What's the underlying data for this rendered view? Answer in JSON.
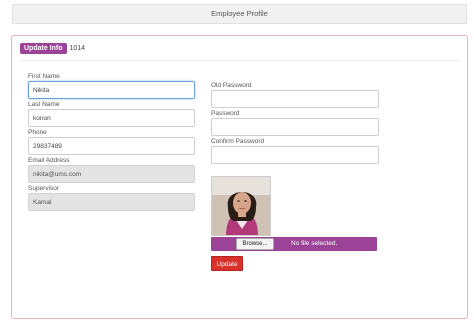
{
  "header": {
    "title": "Employee Profile"
  },
  "panel": {
    "badge": "Update Info",
    "employee_id": "1014"
  },
  "form": {
    "first_name": {
      "label": "First Name",
      "value": "Nikita"
    },
    "last_name": {
      "label": "Last Name",
      "value": "konon"
    },
    "phone": {
      "label": "Phone",
      "value": "29837489"
    },
    "email": {
      "label": "Email Address",
      "value": "nikita@ums.com"
    },
    "supervisor": {
      "label": "Supervisor",
      "value": "Kamal"
    },
    "old_password": {
      "label": "Old Password",
      "value": ""
    },
    "password": {
      "label": "Password",
      "value": ""
    },
    "confirm_password": {
      "label": "Confirm Password",
      "value": ""
    }
  },
  "upload": {
    "browse_label": "Browse...",
    "status": "No file selected."
  },
  "actions": {
    "update_label": "Update"
  },
  "colors": {
    "accent_purple": "#9b4396",
    "update_red": "#d9312a",
    "panel_border": "#e0b7b2"
  }
}
